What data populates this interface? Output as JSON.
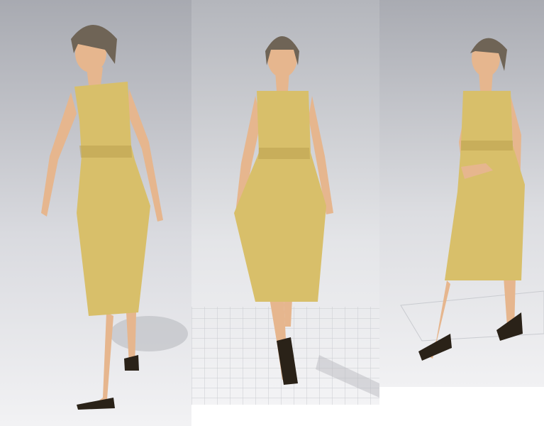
{
  "colors": {
    "dress": "#d8bf6a",
    "dress_shadow": "#b79d4c",
    "skin": "#e6b68e",
    "hair": "#6f6456",
    "shoe": "#2a2218",
    "heel": "#c88a2a",
    "grid": "#c9cbd0"
  },
  "panels": [
    {
      "view": "three-quarter-left"
    },
    {
      "view": "front"
    },
    {
      "view": "three-quarter-right"
    }
  ]
}
